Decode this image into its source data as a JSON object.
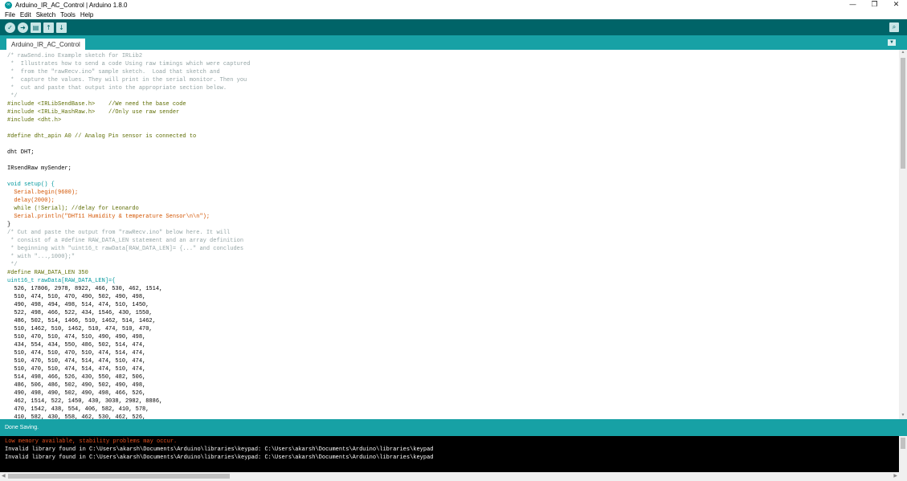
{
  "window": {
    "title": "Arduino_IR_AC_Control | Arduino 1.8.0",
    "controls": {
      "minimize": "—",
      "maximize": "❐",
      "close": "✕"
    }
  },
  "menu": {
    "items": [
      "File",
      "Edit",
      "Sketch",
      "Tools",
      "Help"
    ]
  },
  "toolbar": {
    "buttons": [
      {
        "name": "verify",
        "icon": "check-icon",
        "glyph": "✓"
      },
      {
        "name": "upload",
        "icon": "arrow-right-icon",
        "glyph": "➜"
      },
      {
        "name": "new",
        "icon": "new-file-icon",
        "glyph": "▤"
      },
      {
        "name": "open",
        "icon": "arrow-up-icon",
        "glyph": "↑"
      },
      {
        "name": "save",
        "icon": "arrow-down-icon",
        "glyph": "↓"
      }
    ],
    "serial_monitor": {
      "icon": "magnifier-icon",
      "glyph": "⌕"
    }
  },
  "tabs": {
    "active": "Arduino_IR_AC_Control",
    "menu_glyph": "▼"
  },
  "editor": {
    "lines": [
      {
        "text": "/* rawSend.ino Example sketch for IRLib2",
        "color": "#95a5a6"
      },
      {
        "text": " *  Illustrates how to send a code Using raw timings which were captured",
        "color": "#95a5a6"
      },
      {
        "text": " *  from the \"rawRecv.ino\" sample sketch.  Load that sketch and",
        "color": "#95a5a6"
      },
      {
        "text": " *  capture the values. They will print in the serial monitor. Then you",
        "color": "#95a5a6"
      },
      {
        "text": " *  cut and paste that output into the appropriate section below.",
        "color": "#95a5a6"
      },
      {
        "text": " */",
        "color": "#95a5a6"
      },
      {
        "text": "#include <IRLibSendBase.h>    //We need the base code",
        "color": "#5e6d03"
      },
      {
        "text": "#include <IRLib_HashRaw.h>    //Only use raw sender",
        "color": "#5e6d03"
      },
      {
        "text": "#include <dht.h>",
        "color": "#5e6d03"
      },
      {
        "text": "",
        "color": "#000000"
      },
      {
        "text": "#define dht_apin A0 // Analog Pin sensor is connected to",
        "color": "#5e6d03"
      },
      {
        "text": "",
        "color": "#000000"
      },
      {
        "text": "dht DHT;",
        "color": "#000000"
      },
      {
        "text": "",
        "color": "#000000"
      },
      {
        "text": "IRsendRaw mySender;",
        "color": "#000000"
      },
      {
        "text": "",
        "color": "#000000"
      },
      {
        "text": "void setup() {",
        "color": "#00979c"
      },
      {
        "text": "  Serial.begin(9600);",
        "color": "#d35400"
      },
      {
        "text": "  delay(2000);",
        "color": "#d35400"
      },
      {
        "text": "  while (!Serial); //delay for Leonardo",
        "color": "#5e6d03"
      },
      {
        "text": "  Serial.println(\"DHT11 Humidity & temperature Sensor\\n\\n\");",
        "color": "#d35400"
      },
      {
        "text": "}",
        "color": "#000000"
      },
      {
        "text": "/* Cut and paste the output from \"rawRecv.ino\" below here. It will",
        "color": "#95a5a6"
      },
      {
        "text": " * consist of a #define RAW_DATA_LEN statement and an array definition",
        "color": "#95a5a6"
      },
      {
        "text": " * beginning with \"uint16_t rawData[RAW_DATA_LEN]= {...\" and concludes",
        "color": "#95a5a6"
      },
      {
        "text": " * with \"...,1000};\"",
        "color": "#95a5a6"
      },
      {
        "text": " */",
        "color": "#95a5a6"
      },
      {
        "text": "#define RAW_DATA_LEN 350",
        "color": "#5e6d03"
      },
      {
        "text": "uint16_t rawData[RAW_DATA_LEN]={",
        "color": "#00979c"
      },
      {
        "text": "  526, 17806, 2978, 8922, 466, 530, 462, 1514,",
        "color": "#000000"
      },
      {
        "text": "  510, 474, 510, 470, 490, 502, 490, 498,",
        "color": "#000000"
      },
      {
        "text": "  490, 498, 494, 498, 514, 474, 510, 1450,",
        "color": "#000000"
      },
      {
        "text": "  522, 498, 466, 522, 434, 1546, 430, 1550,",
        "color": "#000000"
      },
      {
        "text": "  486, 502, 514, 1466, 510, 1462, 514, 1462,",
        "color": "#000000"
      },
      {
        "text": "  510, 1462, 510, 1462, 510, 474, 510, 470,",
        "color": "#000000"
      },
      {
        "text": "  510, 470, 510, 474, 510, 490, 490, 498,",
        "color": "#000000"
      },
      {
        "text": "  434, 554, 434, 550, 486, 502, 514, 474,",
        "color": "#000000"
      },
      {
        "text": "  510, 474, 510, 470, 510, 474, 514, 474,",
        "color": "#000000"
      },
      {
        "text": "  510, 470, 510, 474, 514, 474, 510, 474,",
        "color": "#000000"
      },
      {
        "text": "  510, 470, 510, 474, 514, 474, 510, 474,",
        "color": "#000000"
      },
      {
        "text": "  514, 498, 466, 526, 430, 550, 482, 506,",
        "color": "#000000"
      },
      {
        "text": "  486, 506, 486, 502, 490, 502, 490, 498,",
        "color": "#000000"
      },
      {
        "text": "  490, 498, 490, 502, 490, 498, 466, 526,",
        "color": "#000000"
      },
      {
        "text": "  462, 1514, 522, 1450, 430, 3038, 2982, 8886,",
        "color": "#000000"
      },
      {
        "text": "  470, 1542, 438, 554, 406, 582, 410, 578,",
        "color": "#000000"
      },
      {
        "text": "  410, 582, 430, 558, 462, 530, 462, 526,",
        "color": "#000000"
      }
    ]
  },
  "status": {
    "text": "Done Saving."
  },
  "console": {
    "lines": [
      {
        "text": "Low memory available, stability problems may occur.",
        "color": "#e0501f"
      },
      {
        "text": "Invalid library found in C:\\Users\\akarsh\\Documents\\Arduino\\libraries\\keypad: C:\\Users\\akarsh\\Documents\\Arduino\\libraries\\keypad",
        "color": "#ffffff"
      },
      {
        "text": "Invalid library found in C:\\Users\\akarsh\\Documents\\Arduino\\libraries\\keypad: C:\\Users\\akarsh\\Documents\\Arduino\\libraries\\keypad",
        "color": "#ffffff"
      }
    ]
  },
  "scrollbar": {
    "arrow_up": "▲",
    "arrow_down": "▼",
    "arrow_left": "◀",
    "arrow_right": "▶"
  }
}
